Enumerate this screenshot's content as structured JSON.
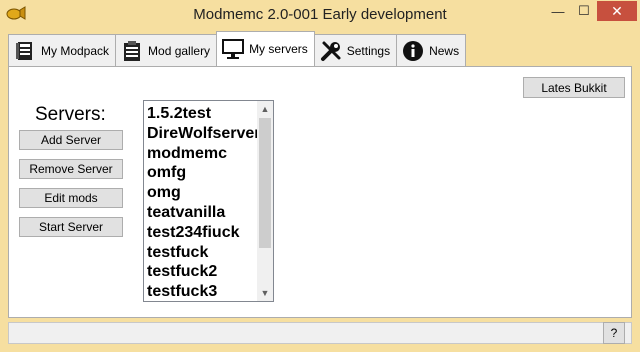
{
  "window": {
    "title": "Modmemc 2.0-001 Early development",
    "minimize_glyph": "—",
    "maximize_glyph": "☐",
    "close_glyph": "✕"
  },
  "tabs": [
    {
      "label": "My Modpack",
      "icon": "book-icon",
      "active": false
    },
    {
      "label": "Mod gallery",
      "icon": "clipboard-icon",
      "active": false
    },
    {
      "label": "My servers",
      "icon": "monitor-icon",
      "active": true
    },
    {
      "label": "Settings",
      "icon": "tools-icon",
      "active": false
    },
    {
      "label": "News",
      "icon": "info-icon",
      "active": false
    }
  ],
  "main": {
    "lates_button": "Lates Bukkit",
    "servers_label": "Servers:",
    "buttons": {
      "add": "Add Server",
      "remove": "Remove Server",
      "edit": "Edit mods",
      "start": "Start Server"
    },
    "servers": [
      "1.5.2test",
      "DireWolfserver",
      "modmemc",
      "omfg",
      "omg",
      "teatvanilla",
      "test234fiuck",
      "testfuck",
      "testfuck2",
      "testfuck3"
    ],
    "scroll_up_glyph": "▲",
    "scroll_down_glyph": "▼"
  },
  "statusbar": {
    "help_label": "?"
  },
  "colors": {
    "titlebar_bg": "#f6dfa0",
    "close_button": "#c7503e",
    "panel_bg": "#ffffff"
  }
}
